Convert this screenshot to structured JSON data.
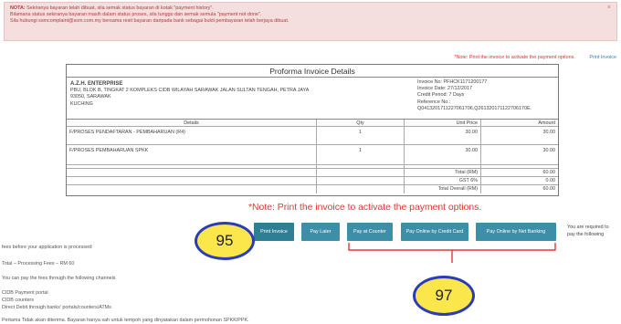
{
  "alert": {
    "nota_label": "NOTA:",
    "line1": "Sekiranya bayaran telah dibuat, sila semak status bayaran di kotak \"payment history\".",
    "line2": "Bilamana status sekiranya bayaran masih dalam status proses, sila tunggu dan semak semula \"payment not done\".",
    "line3": "Sila hubungi ssmcomplaint@ssm.com.my bersama resit bayaran daripada bank sebagai bukti pembayaran telah berjaya dibuat.",
    "close": "×"
  },
  "top_note": "*Note: Print the invoice to activate the payment options.",
  "print_invoice_link": "Print Invoice",
  "invoice": {
    "title": "Proforma Invoice Details",
    "company": {
      "name": "A.Z.H. ENTERPRISE",
      "address1": "PBU, BLOK B, TINGKAT 2 KOMPLEKS CIDB WILAYAH SARAWAK JALAN SULTAN TENGAH, PETRA JAYA",
      "address2": "93050, SARAWAK",
      "address3": "KUCHING"
    },
    "meta": {
      "invoice_no": "Invoice No: PFHCK1171200177",
      "invoice_date": "Invoice Date: 27/12/2017",
      "credit_period": "Credit Period: 7 Days",
      "reference": "Reference No.:",
      "reference_val": "Q0413201711227061706,Q261320171122706170E."
    },
    "columns": [
      "Details",
      "Qty",
      "Unit Price",
      "Amount"
    ],
    "items": [
      {
        "details": "F/PROSES PENDAFTARAN - PEMBAHARUAN (R4)",
        "qty": "1",
        "unit": "30.00",
        "amount": "30.00"
      },
      {
        "details": "F/PROSES PEMBAHARUAN SPKK",
        "qty": "1",
        "unit": "30.00",
        "amount": "30.00"
      }
    ],
    "totals": [
      {
        "label": "Total (RM)",
        "value": "60.00"
      },
      {
        "label": "GST 6%",
        "value": "0.00"
      },
      {
        "label": "Total Overall (RM)",
        "value": "60.00"
      }
    ]
  },
  "big_note": "*Note: Print the invoice to activate the payment options.",
  "buttons": {
    "print": "Print Invoice",
    "later": "Pay Later",
    "counter": "Pay at Counter",
    "credit": "Pay Online by Credit Card",
    "netbank": "Pay Online by Net Banking"
  },
  "required_text": {
    "line1": "You are required to",
    "line2": "pay the following"
  },
  "badges": {
    "b95": "95",
    "b97": "97"
  },
  "left_info": {
    "fees_line": "fees before your application is processed:",
    "total_line": "Total – Processing Fees – RM 60",
    "pay_line": "You can pay the fees through the following channels",
    "channel1": "CIDB Payment portal",
    "channel2": "CIDB counters",
    "channel3": "Direct Debit through banks' portals/counters/ATMs",
    "cutoff": "Pertama Tidak akan diterima. Bayaran hanya sah untuk tempoh yang dinyatakan dalam permohonan SPKK/PPK."
  },
  "colors": {
    "alert_bg": "#f5dede",
    "note_red": "#e63535",
    "button_teal": "#3d8ea7",
    "badge_yellow": "#fbe64b",
    "badge_border": "#2a3cb8"
  }
}
